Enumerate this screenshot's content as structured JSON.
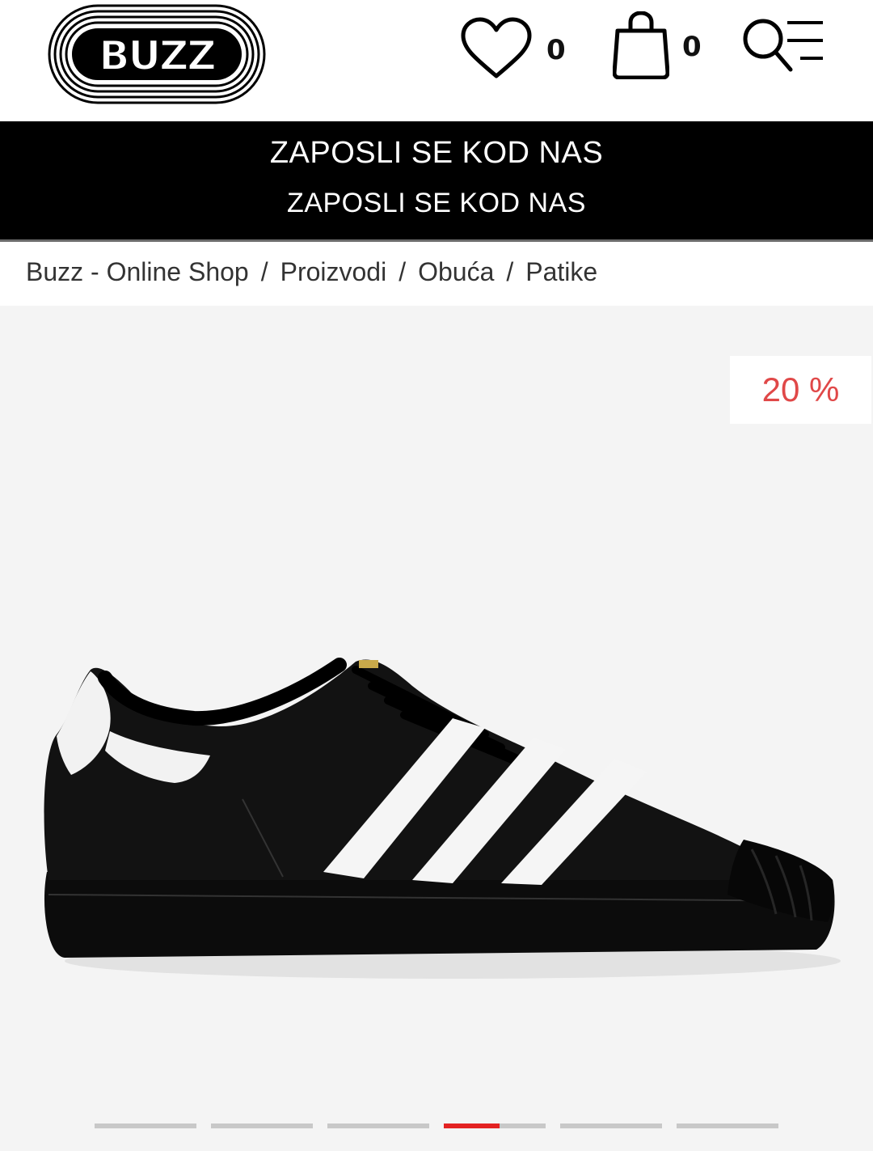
{
  "header": {
    "logo_text": "BUZZ",
    "wishlist_count": "0",
    "cart_count": "0"
  },
  "banner": {
    "line1": "ZAPOSLI SE KOD NAS",
    "line2": "ZAPOSLI SE KOD NAS"
  },
  "breadcrumb": {
    "items": [
      "Buzz - Online Shop",
      "Proizvodi",
      "Obuća",
      "Patike"
    ],
    "separator": "/"
  },
  "product": {
    "discount_badge": "20 %",
    "image_icon": "sneaker-black-white-stripes-icon"
  },
  "gallery": {
    "slides": 6,
    "active_index": 3,
    "active_progress": 0.55
  },
  "colors": {
    "accent_red": "#e32222",
    "badge_text": "#e04848",
    "banner_bg": "#000000"
  }
}
